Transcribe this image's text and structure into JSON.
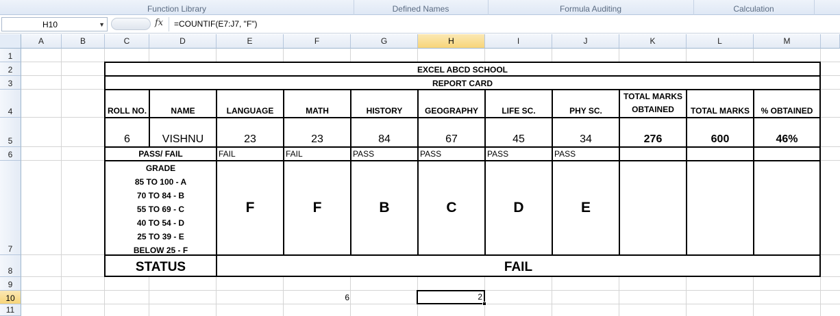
{
  "ribbon": {
    "groups": [
      "Function Library",
      "Defined Names",
      "Formula Auditing",
      "Calculation"
    ]
  },
  "formula_bar": {
    "name_box": "H10",
    "fx": "fx",
    "formula": "=COUNTIF(E7:J7, \"F\")"
  },
  "columns": [
    "A",
    "B",
    "C",
    "D",
    "E",
    "F",
    "G",
    "H",
    "I",
    "J",
    "K",
    "L",
    "M"
  ],
  "selected_column": "H",
  "rows": [
    "1",
    "2",
    "3",
    "4",
    "5",
    "6",
    "7",
    "8",
    "9",
    "10",
    "11"
  ],
  "selected_row": "10",
  "report": {
    "school": "EXCEL ABCD SCHOOL",
    "title": "REPORT CARD",
    "headers": {
      "roll": "ROLL NO.",
      "name": "NAME",
      "language": "LANGUAGE",
      "math": "MATH",
      "history": "HISTORY",
      "geography": "GEOGRAPHY",
      "life": "LIFE SC.",
      "phy": "PHY SC.",
      "obtained_line1": "TOTAL MARKS",
      "obtained_line2": "OBTAINED",
      "total": "TOTAL MARKS",
      "percent": "% OBTAINED"
    },
    "values": {
      "roll": "6",
      "name": "VISHNU",
      "language": "23",
      "math": "23",
      "history": "84",
      "geography": "67",
      "life": "45",
      "phy": "34",
      "obtained": "276",
      "total": "600",
      "percent": "46%"
    },
    "pass_fail_label": "PASS/ FAIL",
    "pass_fail": [
      "FAIL",
      "FAIL",
      "PASS",
      "PASS",
      "PASS",
      "PASS"
    ],
    "grade_scale": [
      "GRADE",
      "85 TO 100 - A",
      "70 TO 84 - B",
      "55 TO 69 - C",
      "40 TO 54 - D",
      "25 TO 39 - E",
      "BELOW 25 - F"
    ],
    "grades": [
      "F",
      "F",
      "B",
      "C",
      "D",
      "E"
    ],
    "status_label": "STATUS",
    "status": "FAIL"
  },
  "extra": {
    "f10": "6",
    "h10": "2"
  }
}
